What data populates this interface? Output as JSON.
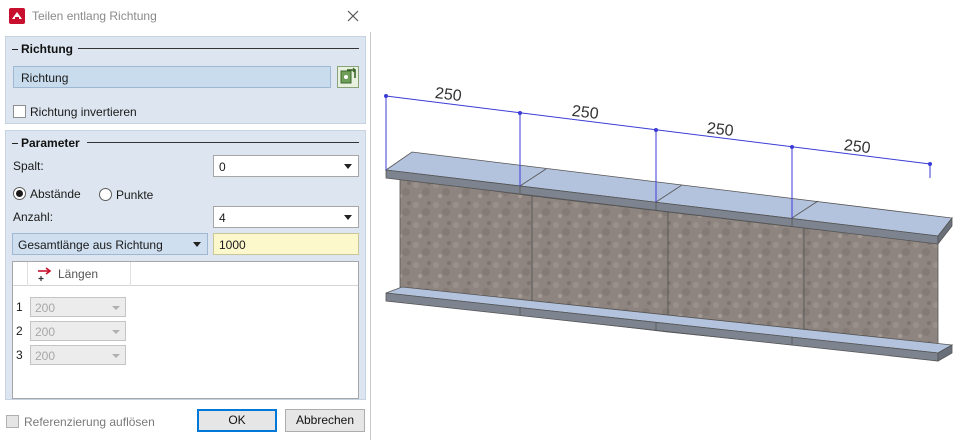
{
  "dialog": {
    "title": "Teilen entlang Richtung",
    "icons": {
      "app": "app-logo-icon",
      "close": "close-icon"
    }
  },
  "richtung_section": {
    "title": "Richtung",
    "field_value": "Richtung",
    "pick_icon": "pick-direction-icon",
    "invert_label": "Richtung invertieren",
    "invert_checked": false
  },
  "parameter_section": {
    "title": "Parameter",
    "spalt_label": "Spalt:",
    "spalt_value": "0",
    "radio_abstaende": "Abstände",
    "radio_punkte": "Punkte",
    "radio_selected": "Abstände",
    "anzahl_label": "Anzahl:",
    "anzahl_value": "4",
    "mode_value": "Gesamtlänge aus Richtung",
    "length_value": "1000",
    "table": {
      "header_icon": "lengths-arrow-icon",
      "header_label": "Längen",
      "rows": [
        {
          "num": "1",
          "value": "200"
        },
        {
          "num": "2",
          "value": "200"
        },
        {
          "num": "3",
          "value": "200"
        }
      ]
    }
  },
  "footer": {
    "reference_label": "Referenzierung auflösen",
    "ok_label": "OK",
    "cancel_label": "Abbrechen"
  },
  "viewport": {
    "dimensions": [
      "250",
      "250",
      "250",
      "250"
    ],
    "colors": {
      "dimension_line": "#3b3bd6",
      "flange": "#b4c3dd",
      "web": "#8f8580"
    }
  }
}
